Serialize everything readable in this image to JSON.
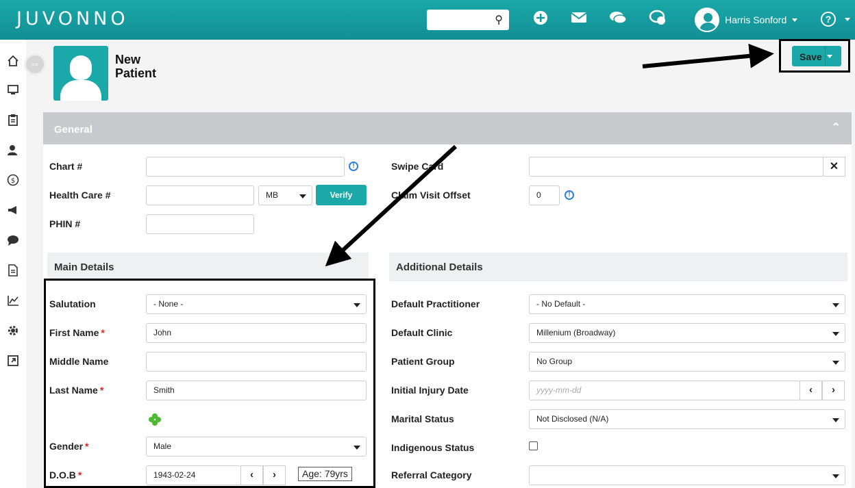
{
  "app": {
    "logo": "JUVONNO"
  },
  "topbar": {
    "icons": [
      "search-icon",
      "add-icon",
      "mail-icon",
      "chat-icon",
      "messages-icon"
    ],
    "user_name": "Harris Sonford",
    "help": "?"
  },
  "header": {
    "title_line1": "New",
    "title_line2": "Patient",
    "save_label": "Save"
  },
  "section": {
    "title": "General"
  },
  "general": {
    "chart_label": "Chart #",
    "health_label": "Health Care #",
    "province_value": "MB",
    "verify_label": "Verify",
    "phin_label": "PHIN #",
    "swipe_label": "Swipe Card",
    "claim_label": "Claim Visit Offset",
    "claim_value": "0"
  },
  "main_details": {
    "title": "Main Details",
    "salutation_label": "Salutation",
    "salutation_value": "- None -",
    "first_label": "First Name",
    "first_value": "John",
    "middle_label": "Middle Name",
    "last_label": "Last Name",
    "last_value": "Smith",
    "gender_label": "Gender",
    "gender_value": "Male",
    "dob_label": "D.O.B",
    "dob_value": "1943-02-24",
    "age_value": "Age: 79yrs",
    "required_mark": "*"
  },
  "additional_details": {
    "title": "Additional Details",
    "practitioner_label": "Default Practitioner",
    "practitioner_value": "- No Default -",
    "clinic_label": "Default Clinic",
    "clinic_value": "Millenium (Broadway)",
    "group_label": "Patient Group",
    "group_value": "No Group",
    "injury_label": "Initial Injury Date",
    "injury_placeholder": "yyyy-mm-dd",
    "marital_label": "Marital Status",
    "marital_value": "Not Disclosed (N/A)",
    "indigenous_label": "Indigenous Status",
    "referral_label": "Referral Category",
    "referral_value": ""
  },
  "colors": {
    "brand": "#1aa8a8",
    "required": "#d9251f",
    "info": "#2f7ed8"
  }
}
